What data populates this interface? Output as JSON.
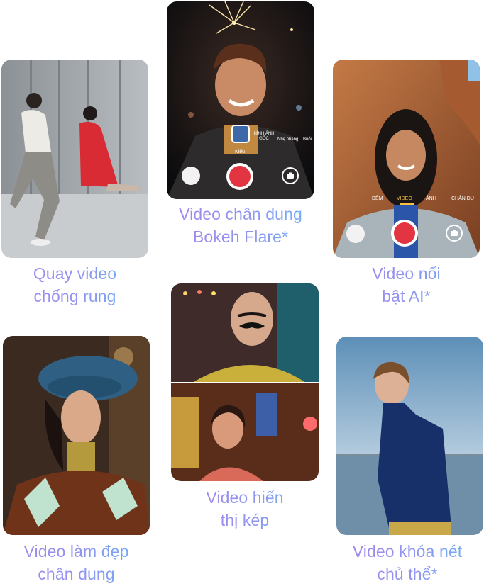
{
  "captions": {
    "stabilization": [
      "Quay video",
      "chống rung"
    ],
    "bokeh": [
      "Video chân dung",
      "Bokeh Flare*"
    ],
    "ai_highlight": [
      "Video nổi",
      "bật AI*"
    ],
    "beauty": [
      "Video làm đẹp",
      "chân dung"
    ],
    "dual": [
      "Video hiển",
      "thị kép"
    ],
    "focus_lock": [
      "Video khóa nét",
      "chủ thể*"
    ]
  },
  "bokeh_ui": {
    "style_options": [
      "HÌNH ẢNH GỐC",
      "Nhẹ nhàng",
      "Buổi"
    ],
    "style_label": "Kiểu"
  },
  "ai_ui": {
    "modes": [
      "ĐÊM",
      "VIDEO",
      "ẢNH",
      "CHÂN DU"
    ]
  },
  "colors": {
    "caption_start": "#a983ea",
    "caption_end": "#67b5f7",
    "shutter": "#e33442",
    "active_mode": "#f5c242"
  }
}
